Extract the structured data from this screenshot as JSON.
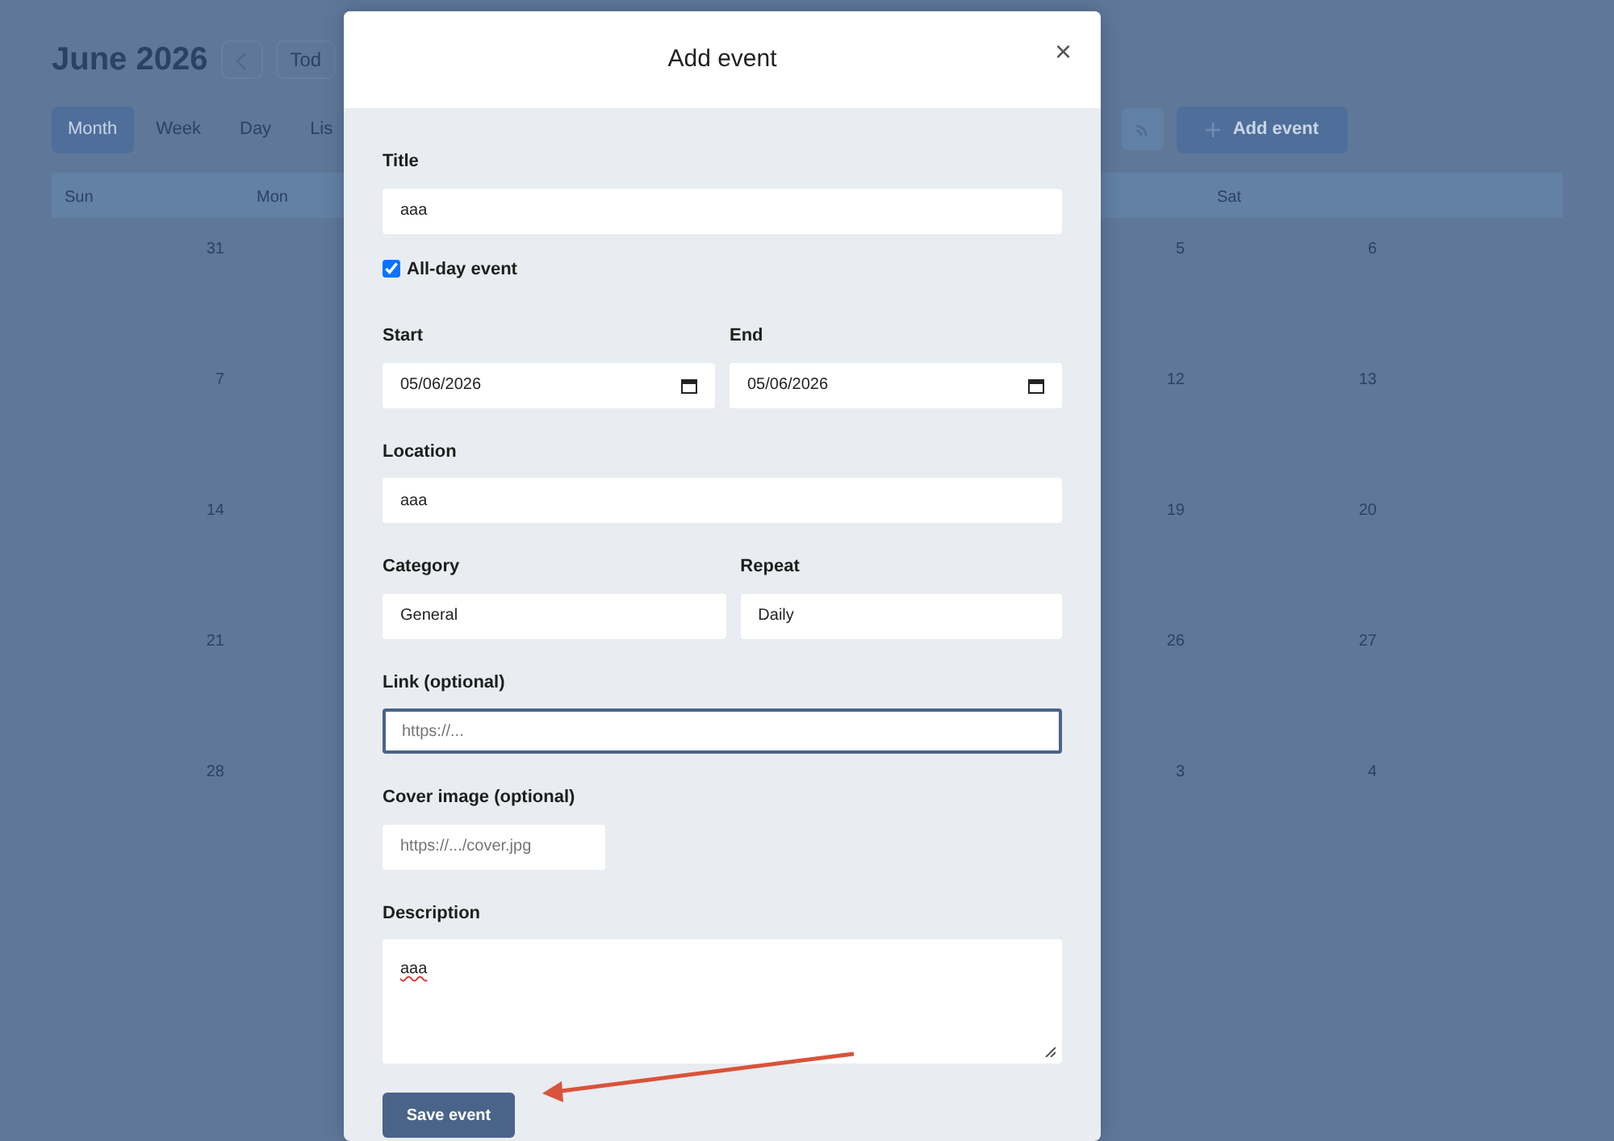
{
  "calendar": {
    "month_title": "June 2026",
    "today_button": "Tod",
    "views": [
      {
        "label": "Month",
        "selected": true
      },
      {
        "label": "Week",
        "selected": false
      },
      {
        "label": "Day",
        "selected": false
      },
      {
        "label": "Lis",
        "selected": false
      }
    ],
    "add_button": "Add event",
    "columns": [
      {
        "weekday": "Sun",
        "days": [
          "31",
          "7",
          "14",
          "21",
          "28"
        ]
      },
      {
        "weekday": "Mon"
      },
      {
        "days": [
          "5",
          "12",
          "19",
          "26",
          "3"
        ]
      },
      {
        "weekday": "Sat",
        "days": [
          "6",
          "13",
          "20",
          "27",
          "4"
        ]
      }
    ]
  },
  "dialog": {
    "title": "Add event",
    "close": "×",
    "fields": [
      {
        "kind": "text",
        "label": "Title",
        "value": "aaa"
      },
      {
        "kind": "checkbox",
        "label": "All-day event",
        "checked": true
      },
      {
        "kind": "pair",
        "items": [
          {
            "kind": "date",
            "label": "Start",
            "value": "05/06/2026"
          },
          {
            "kind": "date",
            "label": "End",
            "value": "05/06/2026"
          }
        ]
      },
      {
        "kind": "text",
        "label": "Location",
        "value": "aaa"
      },
      {
        "kind": "pair",
        "items": [
          {
            "kind": "text",
            "label": "Category",
            "value": "General"
          },
          {
            "kind": "text",
            "label": "Repeat",
            "value": "Daily"
          }
        ]
      },
      {
        "kind": "text",
        "label": "Link (optional)",
        "placeholder": "https://...",
        "focused": true
      },
      {
        "kind": "short",
        "label": "Cover image (optional)",
        "placeholder": "https://.../cover.jpg"
      },
      {
        "kind": "textarea",
        "label": "Description",
        "value": "aaa"
      }
    ],
    "save_button": "Save event"
  }
}
